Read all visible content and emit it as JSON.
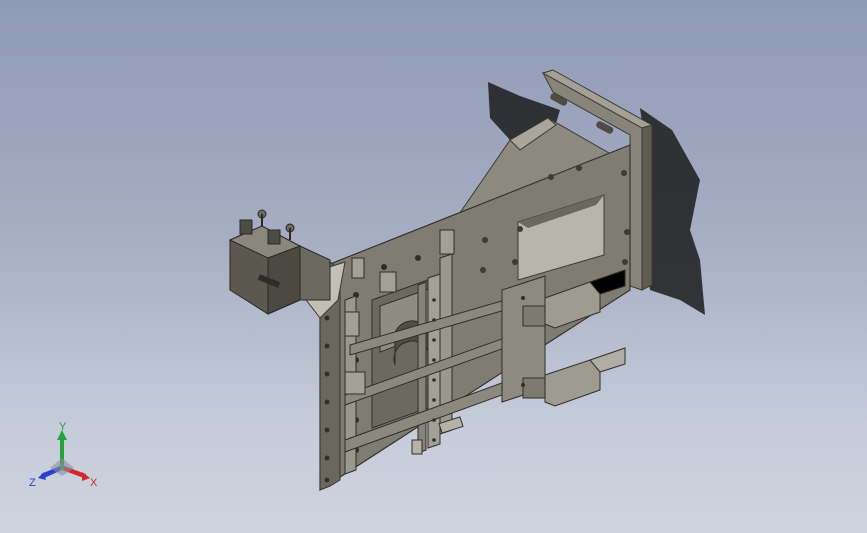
{
  "viewport": {
    "background_top": "#8f9ab5",
    "background_bottom": "#cfd3df",
    "model_color": "#7d7b6f",
    "shadow_color": "#1e1e1e"
  },
  "triad": {
    "x_label": "X",
    "y_label": "Y",
    "z_label": "Z",
    "x_color": "#d22a2a",
    "y_color": "#27a13a",
    "z_color": "#2a3fd2"
  }
}
